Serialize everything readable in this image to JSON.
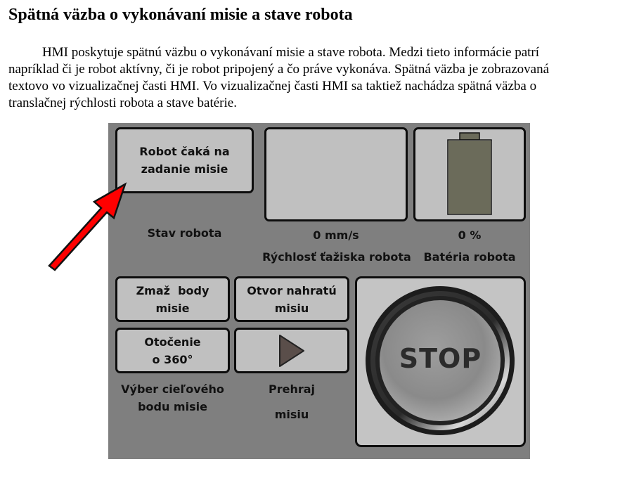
{
  "heading": "Spätná väzba o vykonávaní misie a stave robota",
  "paragraph_lines": [
    "HMI poskytuje spätnú väzbu o vykonávaní misie a stave robota. Medzi tieto informácie patrí",
    "napríklad či je robot aktívny, či je robot pripojený a čo práve vykonáva. Spätná väzba je zobrazovaná",
    "textovo vo vizualizačnej časti HMI. Vo vizualizačnej časti HMI sa taktiež nachádza spätná väzba o",
    "translačnej rýchlosti robota a stave batérie."
  ],
  "hmi": {
    "status_box": {
      "line1": "Robot čaká na",
      "line2": "zadanie misie"
    },
    "status_label": "Stav robota",
    "speed": {
      "value": "0 mm/s",
      "label": "Rýchlosť ťažiska robota"
    },
    "battery": {
      "value": "0 %",
      "label": "Batéria robota",
      "level_fraction": 1.0
    },
    "buttons": {
      "clear_points": {
        "line1": "Zmaž  body",
        "line2": "misie"
      },
      "open_mission": {
        "line1": "Otvor nahratú",
        "line2": "misiu"
      },
      "rotate": {
        "line1": "Otočenie",
        "line2": "o 360°"
      },
      "play_icon": "play-icon",
      "stop": "STOP"
    },
    "target_label": {
      "line1": "Výber cieľového",
      "line2": "bodu misie"
    },
    "play_label": {
      "line1": "Prehraj",
      "line2": "misiu"
    }
  },
  "colors": {
    "panel_bg": "#7f7f7f",
    "tile_bg": "#c0c0c0",
    "battery_fill": "#6b6b5a",
    "arrow": "#ff0000"
  }
}
